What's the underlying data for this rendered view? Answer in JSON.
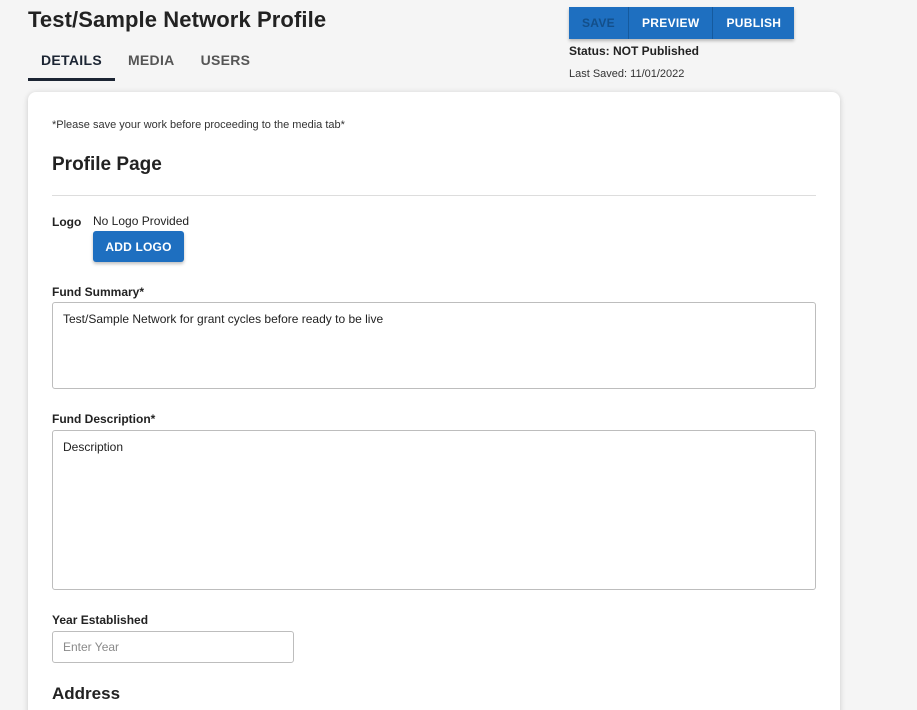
{
  "header": {
    "title": "Test/Sample Network Profile"
  },
  "tabs": [
    {
      "label": "DETAILS",
      "active": true
    },
    {
      "label": "MEDIA",
      "active": false
    },
    {
      "label": "USERS",
      "active": false
    }
  ],
  "actions": {
    "save_label": "SAVE",
    "preview_label": "PREVIEW",
    "publish_label": "PUBLISH"
  },
  "status": {
    "text": "Status: NOT Published",
    "last_saved": "Last Saved: 11/01/2022"
  },
  "form": {
    "note": "*Please save your work before proceeding to the media tab*",
    "section_title": "Profile Page",
    "logo": {
      "label": "Logo",
      "status": "No Logo Provided",
      "button_label": "ADD LOGO"
    },
    "fund_summary": {
      "label": "Fund Summary*",
      "value": "Test/Sample Network for grant cycles before ready to be live"
    },
    "fund_description": {
      "label": "Fund Description*",
      "value": "Description"
    },
    "year_established": {
      "label": "Year Established",
      "value": "",
      "placeholder": "Enter Year"
    },
    "address_title": "Address"
  },
  "colors": {
    "primary_button": "#1e6fc0",
    "active_tab": "#1c2533",
    "page_background": "#f5f5f5"
  }
}
